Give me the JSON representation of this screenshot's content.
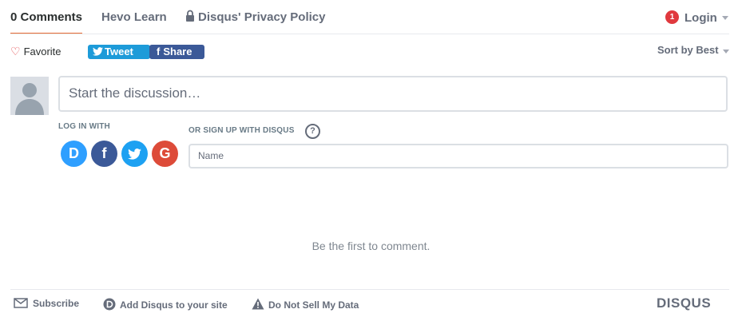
{
  "nav": {
    "tabs": [
      {
        "label": "0 Comments",
        "active": true
      },
      {
        "label": "Hevo Learn",
        "active": false
      },
      {
        "label": "Disqus' Privacy Policy",
        "active": false
      }
    ],
    "login": {
      "badge": "1",
      "label": "Login"
    }
  },
  "actions": {
    "favorite": "Favorite",
    "tweet": "Tweet",
    "share": "Share",
    "sort": "Sort by Best"
  },
  "composer": {
    "placeholder": "Start the discussion…",
    "login_with": "LOG IN WITH",
    "signup_with": "OR SIGN UP WITH DISQUS",
    "help": "?",
    "name_placeholder": "Name",
    "social": [
      {
        "name": "disqus",
        "glyph": "D",
        "color": "#2e9fff"
      },
      {
        "name": "facebook",
        "glyph": "f",
        "color": "#3b5998"
      },
      {
        "name": "twitter",
        "glyph": "",
        "color": "#1da1f2"
      },
      {
        "name": "google",
        "glyph": "G",
        "color": "#dd4b39"
      }
    ]
  },
  "empty_message": "Be the first to comment.",
  "footer": {
    "subscribe": "Subscribe",
    "add_disqus": "Add Disqus to your site",
    "do_not_sell": "Do Not Sell My Data",
    "logo": "DISQUS"
  },
  "colors": {
    "accent": "#e76c35",
    "text": "#2a2e2e",
    "muted": "#656c7a"
  }
}
